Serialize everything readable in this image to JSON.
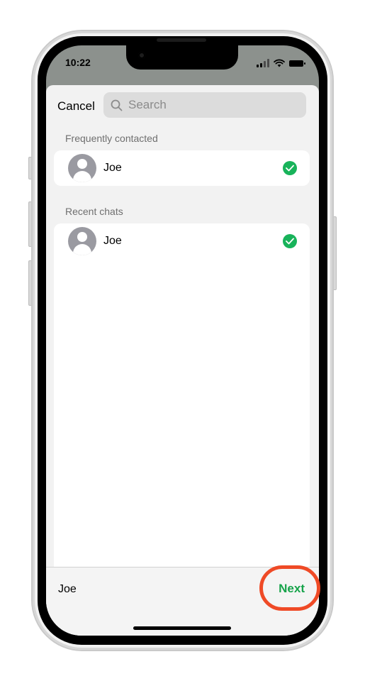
{
  "status_bar": {
    "time": "10:22"
  },
  "header": {
    "cancel_label": "Cancel",
    "search_placeholder": "Search"
  },
  "sections": [
    {
      "title": "Frequently contacted",
      "contacts": [
        {
          "name": "Joe",
          "selected": true
        }
      ]
    },
    {
      "title": "Recent chats",
      "contacts": [
        {
          "name": "Joe",
          "selected": true
        }
      ]
    }
  ],
  "footer": {
    "selected_names": "Joe",
    "next_label": "Next"
  },
  "colors": {
    "accent": "#16a34a",
    "check_bg": "#18b35a",
    "highlight": "#ef4a26"
  }
}
